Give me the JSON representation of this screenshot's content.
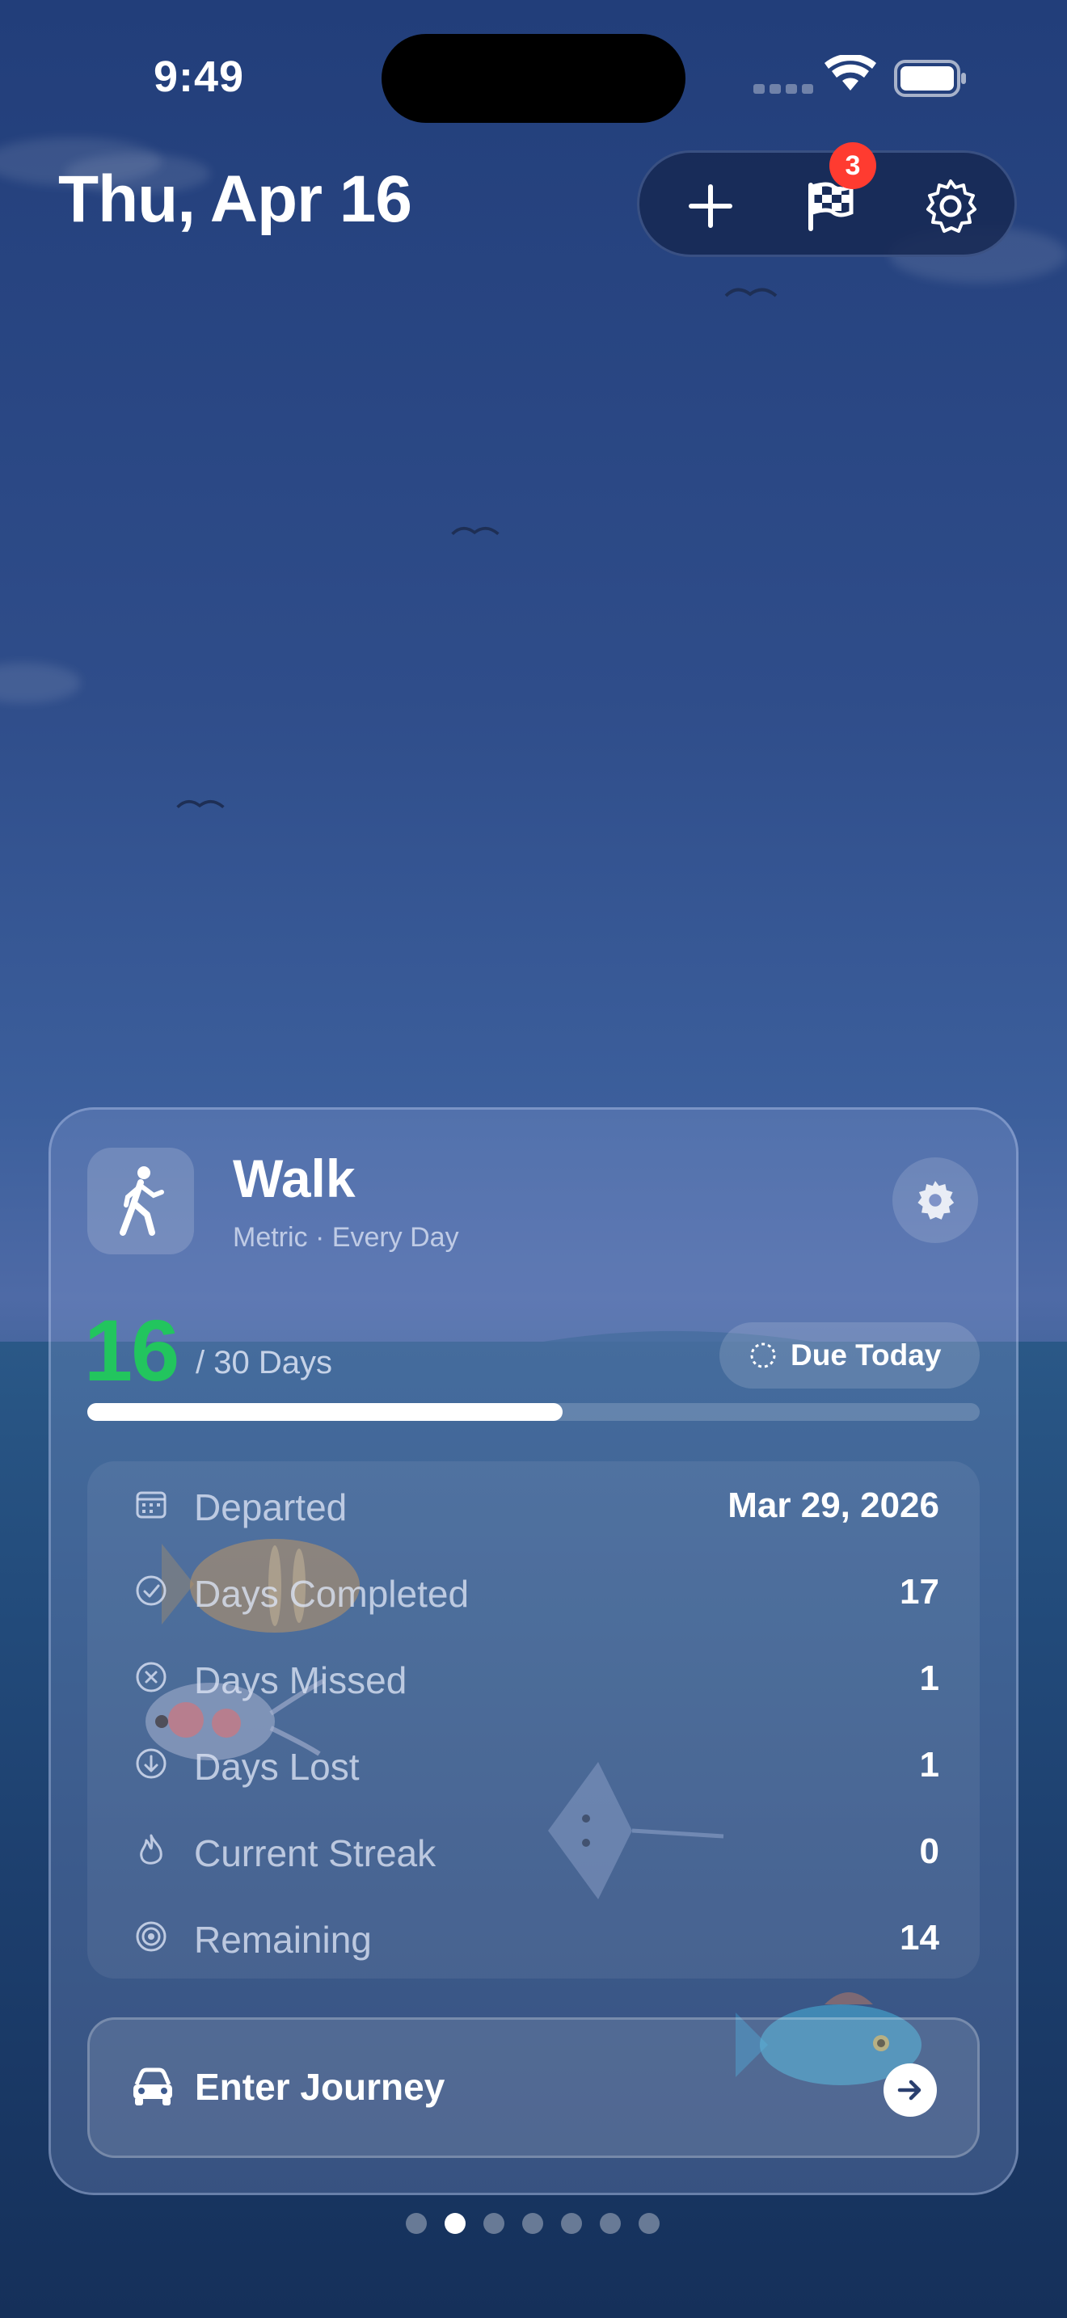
{
  "status_bar": {
    "time": "9:49"
  },
  "header": {
    "date": "Thu, Apr 16",
    "notification_count": "3"
  },
  "habit": {
    "name": "Walk",
    "subtitle": "Metric · Every Day",
    "progress_value": "16",
    "progress_total": "/ 30 Days",
    "progress_fraction": 0.533,
    "due_label": "Due Today"
  },
  "stats": [
    {
      "label": "Departed",
      "value": "Mar 29, 2026",
      "icon": "calendar-icon"
    },
    {
      "label": "Days Completed",
      "value": "17",
      "icon": "check-circle-icon"
    },
    {
      "label": "Days Missed",
      "value": "1",
      "icon": "x-circle-icon"
    },
    {
      "label": "Days Lost",
      "value": "1",
      "icon": "down-arrow-circle-icon"
    },
    {
      "label": "Current Streak",
      "value": "0",
      "icon": "flame-icon"
    },
    {
      "label": "Remaining",
      "value": "14",
      "icon": "target-icon"
    }
  ],
  "action": {
    "label": "Enter Journey"
  },
  "pagination": {
    "count": 7,
    "active_index": 1
  },
  "colors": {
    "progress_accent": "#22c55e",
    "badge": "#ff3b30"
  }
}
